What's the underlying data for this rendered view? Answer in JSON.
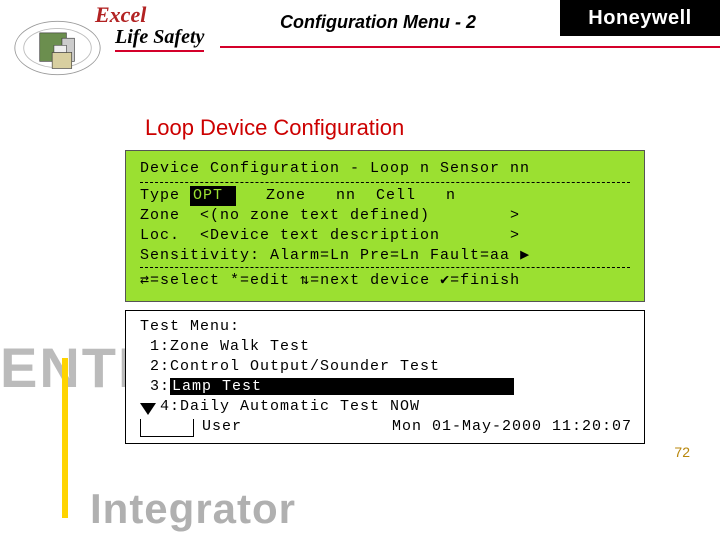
{
  "header": {
    "brand_top": "Excel",
    "brand_sub": "Life Safety",
    "page_title": "Configuration Menu - 2",
    "vendor": "Honeywell"
  },
  "section": {
    "title": "Loop Device Configuration"
  },
  "lcd": {
    "line1": "Device Configuration - Loop n Sensor nn",
    "line2_prefix": "Type ",
    "line2_hl": "OPT ",
    "line2_suffix": "   Zone   nn  Cell   n",
    "line3": "Zone  <(no zone text defined)        >",
    "line4": "Loc.  <Device text description       >",
    "line5_text": "Sensitivity: Alarm=Ln Pre=Ln Fault=aa ",
    "line5_arrow": "▶",
    "line6_lr": "⇄",
    "line6_mid": "=select *=edit ",
    "line6_ud": "⇅",
    "line6_mid2": "=next device ",
    "line6_check": "✔",
    "line6_end": "=finish"
  },
  "test": {
    "title": "Test Menu:",
    "item1": " 1:Zone Walk Test",
    "item2": " 2:Control Output/Sounder Test",
    "item3_prefix": " 3:",
    "item3_hl": "Lamp Test                         ",
    "item4": "4:Daily Automatic Test NOW",
    "footer_user": "User",
    "footer_datetime": "Mon 01-May-2000 11:20:07"
  },
  "page_number": "72"
}
